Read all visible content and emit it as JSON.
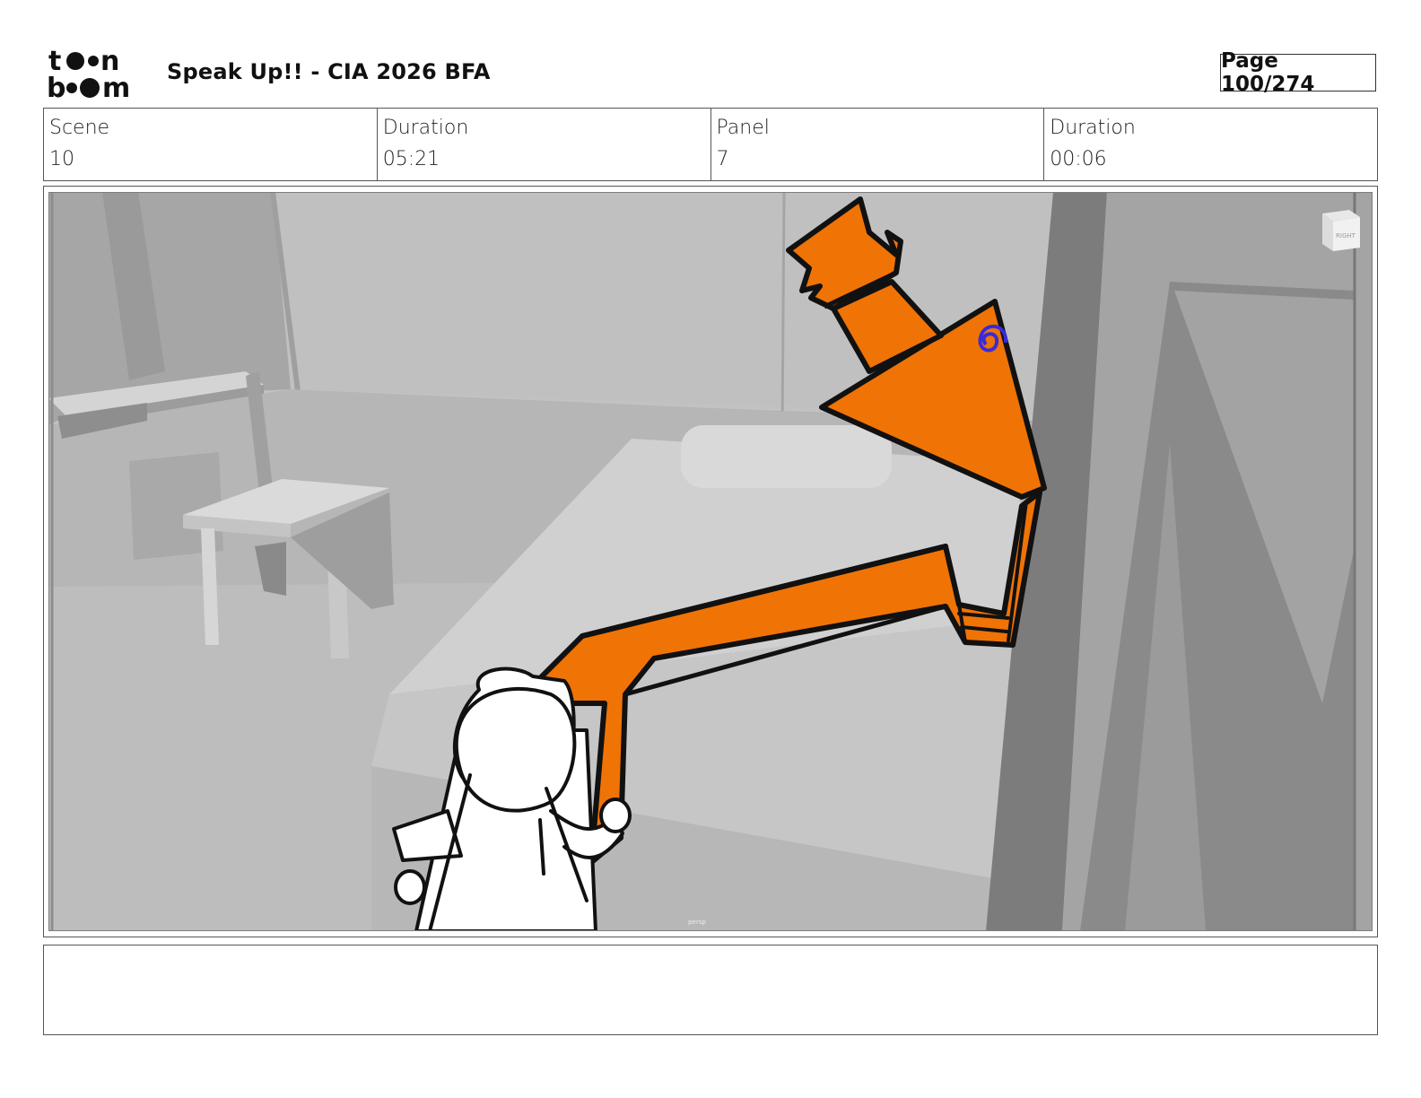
{
  "logo": {
    "text_line1": "toon",
    "text_line2": "boom",
    "icon": "toon-boom-logo"
  },
  "header": {
    "title": "Speak Up!! - CIA 2026 BFA",
    "page": "Page 100/274"
  },
  "info": {
    "scene_label": "Scene",
    "scene_value": "10",
    "scene_duration_label": "Duration",
    "scene_duration_value": "05:21",
    "panel_label": "Panel",
    "panel_value": "7",
    "panel_duration_label": "Duration",
    "panel_duration_value": "00:06"
  },
  "panel": {
    "camera_label": "persp",
    "cube_label": "RIGHT",
    "colors": {
      "sketch_orange": "#f07306",
      "outline": "#111111",
      "swirl": "#3a2bd8",
      "room_gray": "#b9b9b9"
    }
  },
  "notes": {
    "text": ""
  }
}
